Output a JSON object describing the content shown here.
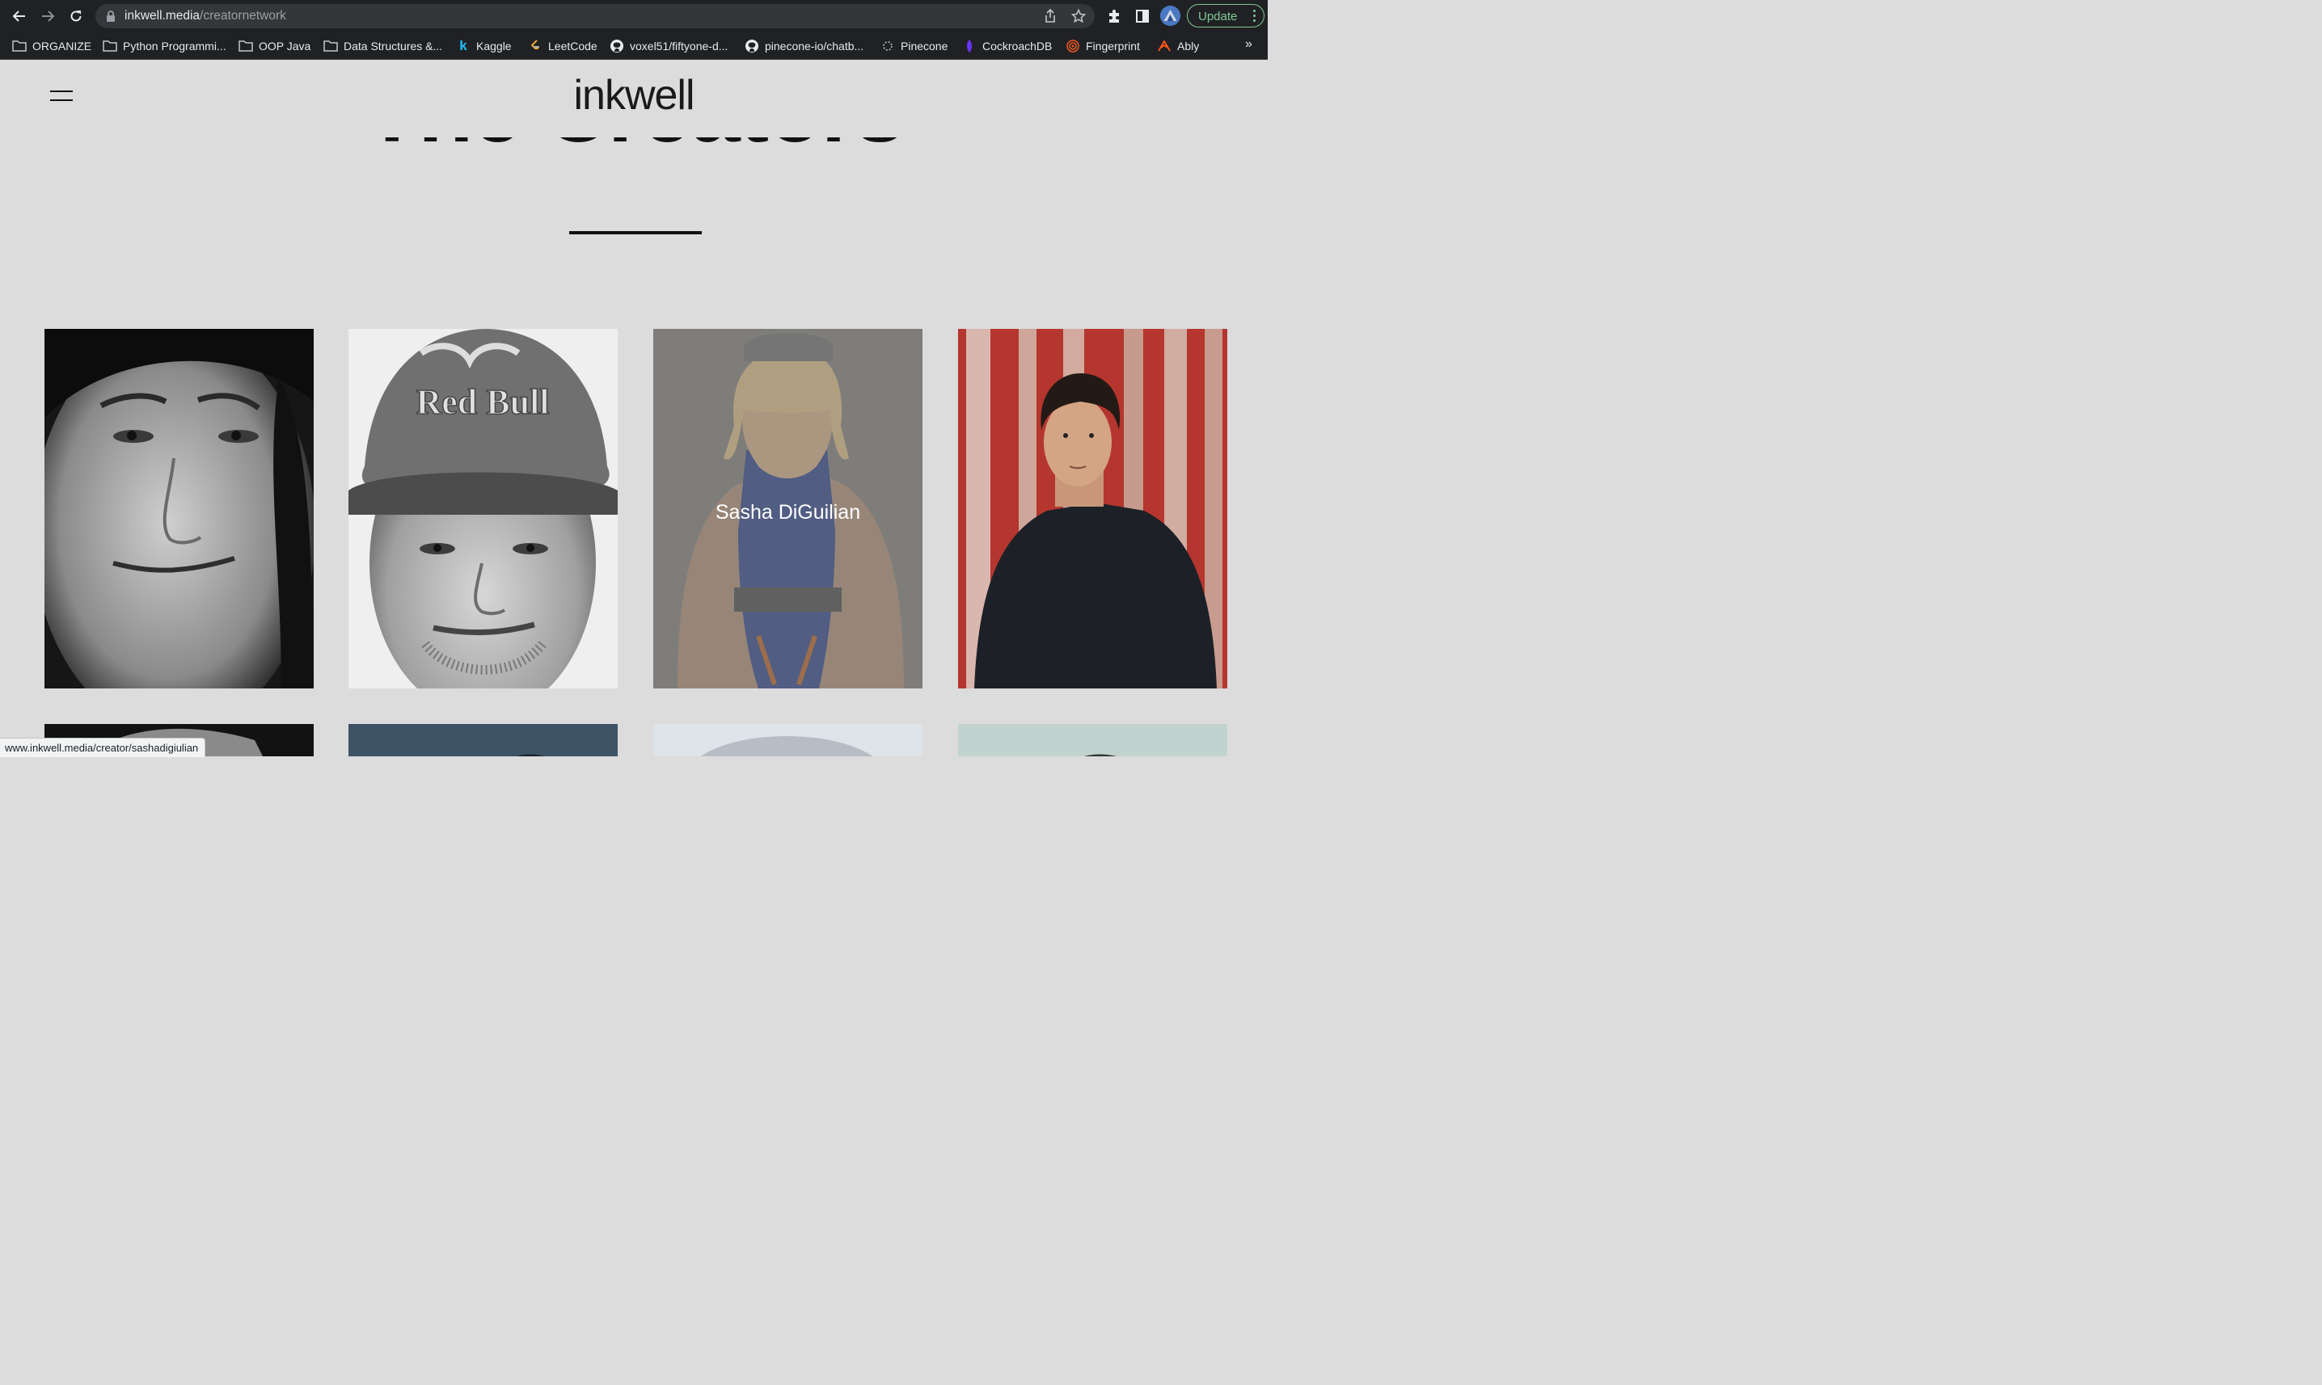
{
  "browser": {
    "url_domain": "inkwell.media",
    "url_path": "/creatornetwork",
    "update_label": "Update",
    "bookmarks": [
      {
        "label": "ORGANIZE",
        "icon": "folder-icon"
      },
      {
        "label": "Python Programmi...",
        "icon": "folder-icon"
      },
      {
        "label": "OOP Java",
        "icon": "folder-icon"
      },
      {
        "label": "Data Structures &...",
        "icon": "folder-icon"
      },
      {
        "label": "Kaggle",
        "icon": "kaggle-icon"
      },
      {
        "label": "LeetCode",
        "icon": "leetcode-icon"
      },
      {
        "label": "voxel51/fiftyone-d...",
        "icon": "github-icon"
      },
      {
        "label": "pinecone-io/chatb...",
        "icon": "github-icon"
      },
      {
        "label": "Pinecone",
        "icon": "pinecone-icon"
      },
      {
        "label": "CockroachDB",
        "icon": "cockroachdb-icon"
      },
      {
        "label": "Fingerprint",
        "icon": "fingerprint-icon"
      },
      {
        "label": "Ably",
        "icon": "ably-icon"
      }
    ],
    "bookmarks_more": "»",
    "status_url": "www.inkwell.media/creator/sashadigiulian"
  },
  "site": {
    "logo": "inkwell",
    "hero_title": "The Creators"
  },
  "creators": [
    {
      "name": "",
      "photo": "bw-portrait-man-long-hair"
    },
    {
      "name": "",
      "photo": "bw-portrait-man-redbull-cap"
    },
    {
      "name": "Sasha DiGuilian",
      "photo": "woman-climber-redbull-beanie",
      "hovered": true
    },
    {
      "name": "",
      "photo": "man-dark-sweater-red-stripes"
    }
  ]
}
